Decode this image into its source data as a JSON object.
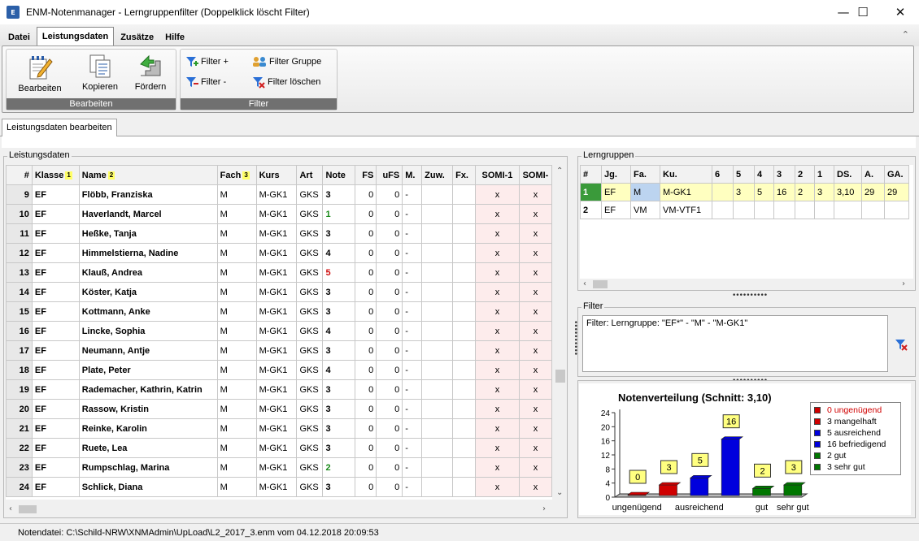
{
  "window": {
    "title": "ENM-Notenmanager - Lerngruppenfilter (Doppelklick löscht Filter)",
    "app_icon_text": "E",
    "min_glyph": "—",
    "max_glyph": "☐",
    "close_glyph": "✕"
  },
  "menu": [
    "Datei",
    "Leistungsdaten",
    "Zusätze",
    "Hilfe"
  ],
  "ribbon": {
    "bearbeiten_group": "Bearbeiten",
    "filter_group": "Filter",
    "buttons": {
      "bearbeiten": "Bearbeiten",
      "kopieren": "Kopieren",
      "foerdern": "Fördern",
      "filter_plus": "Filter +",
      "filter_minus": "Filter -",
      "filter_gruppe": "Filter Gruppe",
      "filter_loeschen": "Filter löschen"
    }
  },
  "doc_tab": "Leistungsdaten bearbeiten",
  "leistungsdaten": {
    "title": "Leistungsdaten",
    "headers": [
      "#",
      "Klasse",
      "Name",
      "Fach",
      "Kurs",
      "Art",
      "Note",
      "FS",
      "uFS",
      "M.",
      "Zuw.",
      "Fx.",
      "SOMI-1",
      "SOMI-"
    ],
    "sort_badges": {
      "klasse": "1",
      "name": "2",
      "fach": "3"
    },
    "rows": [
      {
        "nr": "9",
        "klasse": "EF",
        "name": "Flöbb, Franziska",
        "fach": "M",
        "kurs": "M-GK1",
        "art": "GKS",
        "note": "3",
        "fs": "0",
        "ufs": "0",
        "m": "-",
        "zuw": "",
        "fx": "",
        "somi1": "x",
        "somi2": "x"
      },
      {
        "nr": "10",
        "klasse": "EF",
        "name": "Haverlandt, Marcel",
        "fach": "M",
        "kurs": "M-GK1",
        "art": "GKS",
        "note": "1",
        "fs": "0",
        "ufs": "0",
        "m": "-",
        "zuw": "",
        "fx": "",
        "somi1": "x",
        "somi2": "x"
      },
      {
        "nr": "11",
        "klasse": "EF",
        "name": "Heßke, Tanja",
        "fach": "M",
        "kurs": "M-GK1",
        "art": "GKS",
        "note": "3",
        "fs": "0",
        "ufs": "0",
        "m": "-",
        "zuw": "",
        "fx": "",
        "somi1": "x",
        "somi2": "x"
      },
      {
        "nr": "12",
        "klasse": "EF",
        "name": "Himmelstierna, Nadine",
        "fach": "M",
        "kurs": "M-GK1",
        "art": "GKS",
        "note": "4",
        "fs": "0",
        "ufs": "0",
        "m": "-",
        "zuw": "",
        "fx": "",
        "somi1": "x",
        "somi2": "x"
      },
      {
        "nr": "13",
        "klasse": "EF",
        "name": "Klauß, Andrea",
        "fach": "M",
        "kurs": "M-GK1",
        "art": "GKS",
        "note": "5",
        "fs": "0",
        "ufs": "0",
        "m": "-",
        "zuw": "",
        "fx": "",
        "somi1": "x",
        "somi2": "x"
      },
      {
        "nr": "14",
        "klasse": "EF",
        "name": "Köster, Katja",
        "fach": "M",
        "kurs": "M-GK1",
        "art": "GKS",
        "note": "3",
        "fs": "0",
        "ufs": "0",
        "m": "-",
        "zuw": "",
        "fx": "",
        "somi1": "x",
        "somi2": "x"
      },
      {
        "nr": "15",
        "klasse": "EF",
        "name": "Kottmann, Anke",
        "fach": "M",
        "kurs": "M-GK1",
        "art": "GKS",
        "note": "3",
        "fs": "0",
        "ufs": "0",
        "m": "-",
        "zuw": "",
        "fx": "",
        "somi1": "x",
        "somi2": "x"
      },
      {
        "nr": "16",
        "klasse": "EF",
        "name": "Lincke, Sophia",
        "fach": "M",
        "kurs": "M-GK1",
        "art": "GKS",
        "note": "4",
        "fs": "0",
        "ufs": "0",
        "m": "-",
        "zuw": "",
        "fx": "",
        "somi1": "x",
        "somi2": "x"
      },
      {
        "nr": "17",
        "klasse": "EF",
        "name": "Neumann, Antje",
        "fach": "M",
        "kurs": "M-GK1",
        "art": "GKS",
        "note": "3",
        "fs": "0",
        "ufs": "0",
        "m": "-",
        "zuw": "",
        "fx": "",
        "somi1": "x",
        "somi2": "x"
      },
      {
        "nr": "18",
        "klasse": "EF",
        "name": "Plate, Peter",
        "fach": "M",
        "kurs": "M-GK1",
        "art": "GKS",
        "note": "4",
        "fs": "0",
        "ufs": "0",
        "m": "-",
        "zuw": "",
        "fx": "",
        "somi1": "x",
        "somi2": "x"
      },
      {
        "nr": "19",
        "klasse": "EF",
        "name": "Rademacher, Kathrin, Katrin",
        "fach": "M",
        "kurs": "M-GK1",
        "art": "GKS",
        "note": "3",
        "fs": "0",
        "ufs": "0",
        "m": "-",
        "zuw": "",
        "fx": "",
        "somi1": "x",
        "somi2": "x"
      },
      {
        "nr": "20",
        "klasse": "EF",
        "name": "Rassow, Kristin",
        "fach": "M",
        "kurs": "M-GK1",
        "art": "GKS",
        "note": "3",
        "fs": "0",
        "ufs": "0",
        "m": "-",
        "zuw": "",
        "fx": "",
        "somi1": "x",
        "somi2": "x"
      },
      {
        "nr": "21",
        "klasse": "EF",
        "name": "Reinke, Karolin",
        "fach": "M",
        "kurs": "M-GK1",
        "art": "GKS",
        "note": "3",
        "fs": "0",
        "ufs": "0",
        "m": "-",
        "zuw": "",
        "fx": "",
        "somi1": "x",
        "somi2": "x"
      },
      {
        "nr": "22",
        "klasse": "EF",
        "name": "Ruete, Lea",
        "fach": "M",
        "kurs": "M-GK1",
        "art": "GKS",
        "note": "3",
        "fs": "0",
        "ufs": "0",
        "m": "-",
        "zuw": "",
        "fx": "",
        "somi1": "x",
        "somi2": "x"
      },
      {
        "nr": "23",
        "klasse": "EF",
        "name": "Rumpschlag, Marina",
        "fach": "M",
        "kurs": "M-GK1",
        "art": "GKS",
        "note": "2",
        "fs": "0",
        "ufs": "0",
        "m": "-",
        "zuw": "",
        "fx": "",
        "somi1": "x",
        "somi2": "x"
      },
      {
        "nr": "24",
        "klasse": "EF",
        "name": "Schlick, Diana",
        "fach": "M",
        "kurs": "M-GK1",
        "art": "GKS",
        "note": "3",
        "fs": "0",
        "ufs": "0",
        "m": "-",
        "zuw": "",
        "fx": "",
        "somi1": "x",
        "somi2": "x"
      }
    ],
    "note_colors": {
      "1": "#1a8a1a",
      "2": "#1a8a1a",
      "5": "#d01010"
    }
  },
  "lerngruppen": {
    "title": "Lerngruppen",
    "headers": [
      "#",
      "Jg.",
      "Fa.",
      "Ku.",
      "6",
      "5",
      "4",
      "3",
      "2",
      "1",
      "DS.",
      "A.",
      "GA."
    ],
    "rows": [
      [
        "1",
        "EF",
        "M",
        "M-GK1",
        "",
        "3",
        "5",
        "16",
        "2",
        "3",
        "3,10",
        "29",
        "29"
      ],
      [
        "2",
        "EF",
        "VM",
        "VM-VTF1",
        "",
        "",
        "",
        "",
        "",
        "",
        "",
        "",
        ""
      ]
    ]
  },
  "filter": {
    "title": "Filter",
    "text": "Filter: Lerngruppe: \"EF*\" - \"M\" - \"M-GK1\""
  },
  "status": {
    "text": "Notendatei: C:\\Schild-NRW\\XNMAdmin\\UpLoad\\L2_2017_3.enm vom 04.12.2018 20:09:53"
  },
  "chart_data": {
    "type": "bar",
    "title": "Notenverteilung (Schnitt: 3,10)",
    "categories": [
      "ungenügend",
      "mangelhaft",
      "ausreichend",
      "befriedigend",
      "gut",
      "sehr gut"
    ],
    "tick_labels_shown": [
      "ungenügend",
      "ausreichend",
      "gut",
      "sehr gut"
    ],
    "values": [
      0,
      3,
      5,
      16,
      2,
      3
    ],
    "colors": [
      "#d00000",
      "#d00000",
      "#0000dd",
      "#0000dd",
      "#007700",
      "#007700"
    ],
    "legend": [
      "0 ungenügend",
      "3 mangelhaft",
      "5 ausreichend",
      "16 befriedigend",
      "2 gut",
      "3 sehr gut"
    ],
    "legend_first_color": "#d00000",
    "ylim": [
      0,
      24
    ],
    "yticks": [
      0,
      4,
      8,
      12,
      16,
      20,
      24
    ],
    "grid": false,
    "legend_position": "right"
  }
}
